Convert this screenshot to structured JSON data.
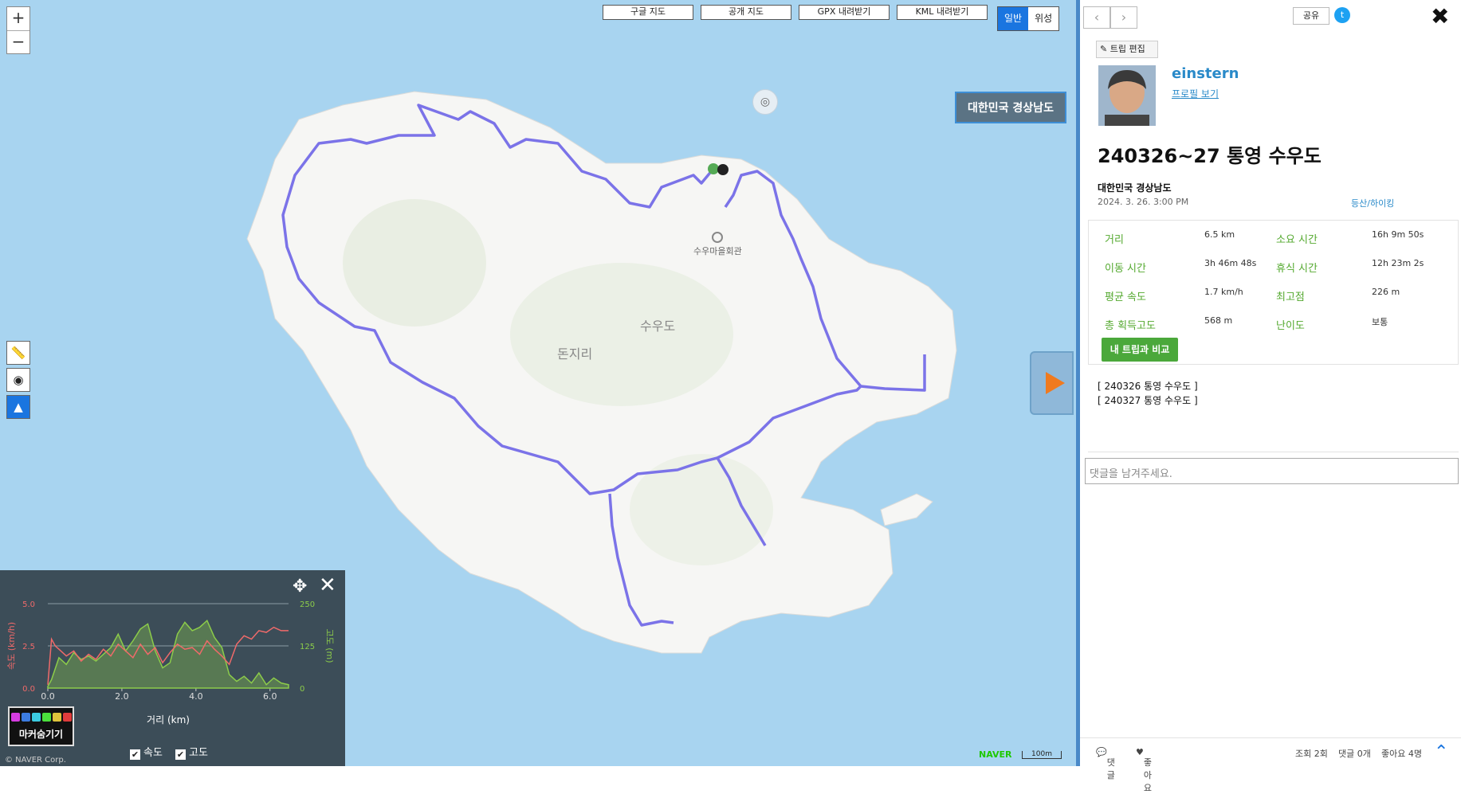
{
  "map": {
    "zoom_in": "+",
    "zoom_out": "−",
    "top_buttons": [
      "구글 지도",
      "공개 지도",
      "GPX 내려받기",
      "KML 내려받기"
    ],
    "map_types": [
      "일반",
      "위성"
    ],
    "region_label": "대한민국 경상남도",
    "island_label": "수우도",
    "village_label": "돈지리",
    "poi_label": "수우마을회관",
    "naver_logo": "NAVER",
    "scale_label": "100m",
    "route_color": "#7b73e8",
    "sea_color": "#a8d4f0"
  },
  "chart_data": {
    "type": "line",
    "xlabel": "거리 (km)",
    "ylabel_left": "속도 (km/h)",
    "ylabel_right": "고도 (m)",
    "x_ticks": [
      "0.0",
      "2.0",
      "4.0",
      "6.0"
    ],
    "y_left_ticks": [
      "0.0",
      "2.5",
      "5.0"
    ],
    "y_right_ticks": [
      "0",
      "125",
      "250"
    ],
    "xlim": [
      0,
      6.5
    ],
    "ylim_left": [
      0,
      5
    ],
    "ylim_right": [
      0,
      250
    ],
    "series": [
      {
        "name": "속도",
        "color": "#f06a6a",
        "x": [
          0,
          0.1,
          0.2,
          0.3,
          0.5,
          0.7,
          0.9,
          1.1,
          1.3,
          1.5,
          1.7,
          1.9,
          2.1,
          2.3,
          2.5,
          2.7,
          2.9,
          3.1,
          3.3,
          3.5,
          3.7,
          3.9,
          4.1,
          4.3,
          4.5,
          4.7,
          4.9,
          5.1,
          5.3,
          5.5,
          5.7,
          5.9,
          6.1,
          6.3,
          6.5
        ],
        "values": [
          0.2,
          2.9,
          2.5,
          2.3,
          1.9,
          2.2,
          1.6,
          2.0,
          1.7,
          2.3,
          1.9,
          2.6,
          2.2,
          1.8,
          2.6,
          2.0,
          2.4,
          1.5,
          2.1,
          2.6,
          2.3,
          2.4,
          2.0,
          2.8,
          2.3,
          1.9,
          1.4,
          2.6,
          3.1,
          2.9,
          3.4,
          3.3,
          3.6,
          3.4,
          3.4
        ]
      },
      {
        "name": "고도",
        "color": "#8ccc4a",
        "x": [
          0,
          0.1,
          0.3,
          0.5,
          0.7,
          0.9,
          1.1,
          1.3,
          1.5,
          1.7,
          1.9,
          2.1,
          2.3,
          2.5,
          2.7,
          2.9,
          3.1,
          3.3,
          3.5,
          3.7,
          3.9,
          4.1,
          4.3,
          4.5,
          4.7,
          4.9,
          5.1,
          5.3,
          5.5,
          5.7,
          5.9,
          6.1,
          6.3,
          6.5
        ],
        "values": [
          5,
          25,
          90,
          70,
          105,
          85,
          95,
          80,
          100,
          120,
          160,
          110,
          140,
          175,
          190,
          110,
          60,
          75,
          160,
          195,
          170,
          180,
          200,
          150,
          120,
          40,
          20,
          35,
          15,
          45,
          10,
          30,
          15,
          10
        ]
      }
    ]
  },
  "chart_panel": {
    "markers_label": "마커숨기기",
    "marker_colors": [
      "#d63ce0",
      "#3c7ce0",
      "#3ccbe0",
      "#4be03c",
      "#e0c43c",
      "#e03c3c"
    ],
    "checkbox_speed": "속도",
    "checkbox_altitude": "고도",
    "copyright": "© NAVER Corp."
  },
  "panel": {
    "share": "공유",
    "edit": "트립 편집",
    "username": "einstern",
    "profile_link": "프로필 보기",
    "title": "240326~27 통영 수우도",
    "place": "대한민국 경상남도",
    "date": "2024. 3. 26. 3:00 PM",
    "category": "등산/하이킹",
    "stats": [
      {
        "label": "거리",
        "value": "6.5 km"
      },
      {
        "label": "소요 시간",
        "value": "16h 9m 50s"
      },
      {
        "label": "이동 시간",
        "value": "3h 46m 48s"
      },
      {
        "label": "휴식 시간",
        "value": "12h 23m 2s"
      },
      {
        "label": "평균 속도",
        "value": "1.7 km/h"
      },
      {
        "label": "최고점",
        "value": "226 m"
      },
      {
        "label": "총 획득고도",
        "value": "568 m"
      },
      {
        "label": "난이도",
        "value": "보통"
      }
    ],
    "compare_button": "내 트립과 비교",
    "sub_trips": [
      "[ 240326 통영 수우도 ]",
      "[ 240327 통영 수우도 ]"
    ],
    "comment_placeholder": "댓글을 남겨주세요.",
    "footer": {
      "comment": "댓글",
      "like": "좋아요",
      "views": "조회 2회",
      "comments_count": "댓글 0개",
      "likes_count": "좋아요 4명"
    }
  }
}
